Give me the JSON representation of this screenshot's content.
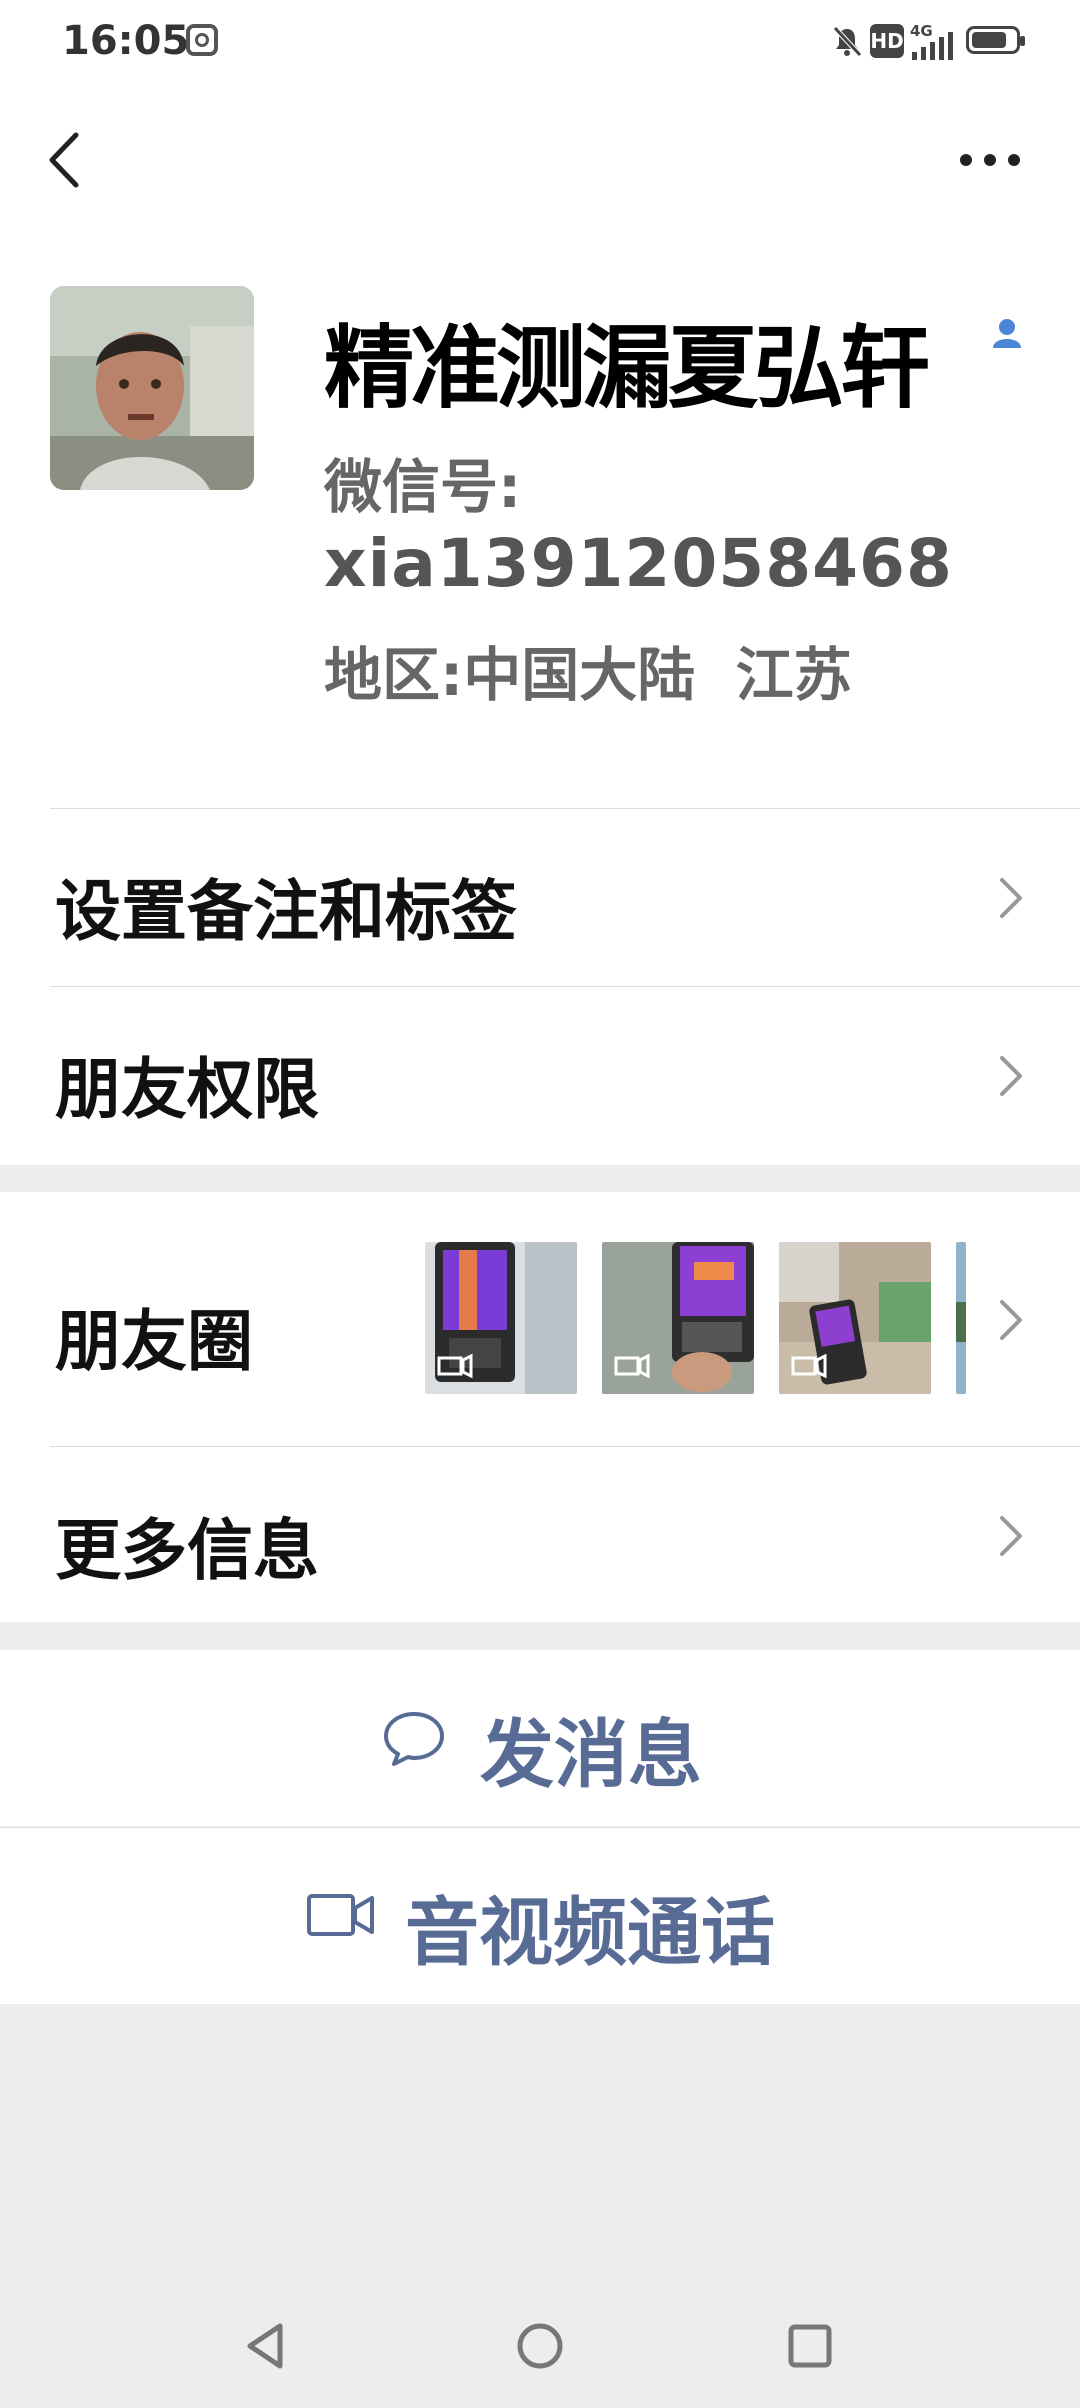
{
  "status_bar": {
    "time": "16:05",
    "network": "4G",
    "hd_badge": "HD"
  },
  "profile": {
    "name": "精准测漏夏弘轩",
    "wechat_id_label": "微信号:",
    "wechat_id": "xia13912058468",
    "region": "地区:中国大陆  江苏"
  },
  "menu": {
    "set_remark": "设置备注和标签",
    "friend_permission": "朋友权限",
    "moments": "朋友圈",
    "more_info": "更多信息"
  },
  "actions": {
    "send_message": "发消息",
    "video_call": "音视频通话"
  },
  "colors": {
    "link_blue": "#576b95",
    "background": "#ededed"
  }
}
